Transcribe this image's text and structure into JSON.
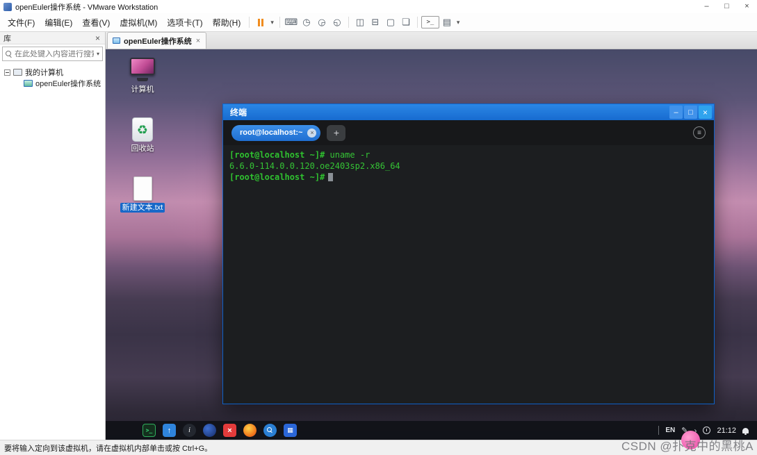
{
  "window": {
    "title": "openEuler操作系统 - VMware Workstation",
    "minimize": "–",
    "maximize": "□",
    "close": "×"
  },
  "menubar": {
    "items": [
      "文件(F)",
      "编辑(E)",
      "查看(V)",
      "虚拟机(M)",
      "选项卡(T)",
      "帮助(H)"
    ]
  },
  "toolbar": {
    "dropdown_arrow": "▾",
    "icons": [
      {
        "name": "send-ctrl-alt-del",
        "glyph": "⌨"
      },
      {
        "name": "take-snapshot",
        "glyph": "◷"
      },
      {
        "name": "revert-snapshot",
        "glyph": "◶"
      },
      {
        "name": "manage-snapshots",
        "glyph": "◵"
      },
      {
        "name": "show-library",
        "glyph": "◫"
      },
      {
        "name": "show-thumbnail-bar",
        "glyph": "⊟"
      },
      {
        "name": "fullscreen",
        "glyph": "▢"
      },
      {
        "name": "unity",
        "glyph": "❏"
      },
      {
        "name": "console",
        "glyph": ">_"
      },
      {
        "name": "view-options",
        "glyph": "▤"
      }
    ]
  },
  "sidebar": {
    "header": "库",
    "close": "×",
    "search_placeholder": "在此处键入内容进行搜索",
    "dropdown_arrow": "▾",
    "tree": [
      {
        "label": "我的计算机"
      },
      {
        "label": "openEuler操作系统"
      }
    ]
  },
  "tabs": {
    "active": "openEuler操作系统",
    "close": "×"
  },
  "desktop": {
    "recycle_glyph": "♻",
    "icons": [
      {
        "name": "computer",
        "label": "计算机"
      },
      {
        "name": "recycle-bin",
        "label": "回收站"
      },
      {
        "name": "text-file",
        "label": "新建文本.txt",
        "selected": true
      }
    ]
  },
  "terminal": {
    "title": "终端",
    "minimize": "–",
    "maximize": "□",
    "close": "×",
    "tab_label": "root@localhost:~",
    "tab_close": "×",
    "new_tab": "+",
    "menu_icon": "≡",
    "lines": [
      {
        "prompt": "[root@localhost ~]#",
        "text": " uname -r"
      },
      {
        "prompt": "",
        "text": "6.6.0-114.0.0.120.oe2403sp2.x86_64"
      },
      {
        "prompt": "[root@localhost ~]#",
        "text": ""
      }
    ]
  },
  "vm_taskbar": {
    "lang": "EN",
    "time": "21:12",
    "pen_glyph": "✎",
    "chevron_glyph": "›",
    "icons": [
      {
        "name": "app-launcher",
        "glyph": ""
      },
      {
        "name": "terminal",
        "glyph": ">_"
      },
      {
        "name": "file-manager",
        "glyph": "↑"
      },
      {
        "name": "help",
        "glyph": "i"
      },
      {
        "name": "browser",
        "glyph": ""
      },
      {
        "name": "close-app",
        "glyph": "×"
      },
      {
        "name": "firefox",
        "glyph": ""
      },
      {
        "name": "search",
        "glyph": ""
      },
      {
        "name": "notes",
        "glyph": "▦"
      }
    ]
  },
  "statusbar": {
    "message": "要将输入定向到该虚拟机，请在虚拟机内部单击或按 Ctrl+G。"
  },
  "watermark": {
    "text": "CSDN @扑克中的黑桃A"
  }
}
